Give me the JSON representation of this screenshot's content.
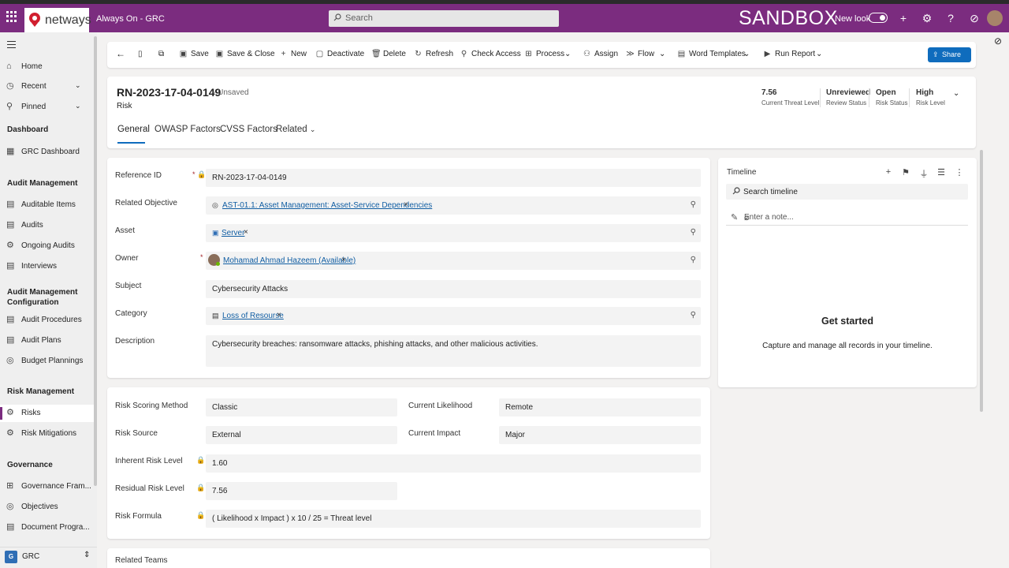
{
  "topbar": {
    "logo_text": "netways",
    "app_name": "Always On - GRC",
    "search_placeholder": "Search",
    "environment": "SANDBOX",
    "new_look_label": "New look",
    "brand_color": "#7b2c7f"
  },
  "sidebar": {
    "items": [
      {
        "label": "Home",
        "icon": "home-icon"
      },
      {
        "label": "Recent",
        "icon": "clock-icon"
      },
      {
        "label": "Pinned",
        "icon": "pin-icon"
      }
    ],
    "sections": [
      {
        "title": "Dashboard",
        "items": [
          "GRC Dashboard"
        ]
      },
      {
        "title": "Audit Management",
        "items": [
          "Auditable Items",
          "Audits",
          "Ongoing Audits",
          "Interviews"
        ]
      },
      {
        "title": "Audit Management Configuration",
        "items": [
          "Audit Procedures",
          "Audit Plans",
          "Budget Plannings"
        ]
      },
      {
        "title": "Risk Management",
        "items": [
          "Risks",
          "Risk Mitigations"
        ]
      },
      {
        "title": "Governance",
        "items": [
          "Governance Fram...",
          "Objectives",
          "Document Progra..."
        ]
      }
    ],
    "area": {
      "badge": "G",
      "label": "GRC"
    }
  },
  "commands": {
    "save": "Save",
    "save_close": "Save & Close",
    "new": "New",
    "deactivate": "Deactivate",
    "delete": "Delete",
    "refresh": "Refresh",
    "check_access": "Check Access",
    "process": "Process",
    "assign": "Assign",
    "flow": "Flow",
    "word_templates": "Word Templates",
    "run_report": "Run Report",
    "share": "Share"
  },
  "record": {
    "title": "RN-2023-17-04-0149",
    "status": "- Unsaved",
    "entity": "Risk",
    "header_fields": [
      {
        "value": "7.56",
        "label": "Current Threat Level"
      },
      {
        "value": "Unreviewed",
        "label": "Review Status"
      },
      {
        "value": "Open",
        "label": "Risk Status"
      },
      {
        "value": "High",
        "label": "Risk Level"
      }
    ],
    "tabs": [
      "General",
      "OWASP Factors",
      "CVSS Factors",
      "Related"
    ]
  },
  "general": {
    "reference_id": {
      "label": "Reference ID",
      "value": "RN-2023-17-04-0149"
    },
    "related_objective": {
      "label": "Related Objective",
      "value": "AST-01.1: Asset Management: Asset-Service Dependencies"
    },
    "asset": {
      "label": "Asset",
      "value": "Server"
    },
    "owner": {
      "label": "Owner",
      "value": "Mohamad Ahmad Hazeem (Available)"
    },
    "subject": {
      "label": "Subject",
      "value": "Cybersecurity Attacks"
    },
    "category": {
      "label": "Category",
      "value": "Loss of Resourse"
    },
    "description": {
      "label": "Description",
      "value": "Cybersecurity breaches: ransomware attacks, phishing attacks, and other malicious activities."
    }
  },
  "scoring": {
    "method": {
      "label": "Risk Scoring Method",
      "value": "Classic"
    },
    "source": {
      "label": "Risk Source",
      "value": "External"
    },
    "likelihood": {
      "label": "Current Likelihood",
      "value": "Remote"
    },
    "impact": {
      "label": "Current Impact",
      "value": "Major"
    },
    "inherent": {
      "label": "Inherent Risk Level",
      "value": "1.60"
    },
    "residual": {
      "label": "Residual Risk Level",
      "value": "7.56"
    },
    "formula": {
      "label": "Risk Formula",
      "value": "( Likelihood x Impact ) x 10 / 25 = Threat level"
    }
  },
  "timeline": {
    "title": "Timeline",
    "search_placeholder": "Search timeline",
    "note_placeholder": "Enter a note...",
    "empty_title": "Get started",
    "empty_caption": "Capture and manage all records in your timeline."
  },
  "related_teams": "Related Teams"
}
